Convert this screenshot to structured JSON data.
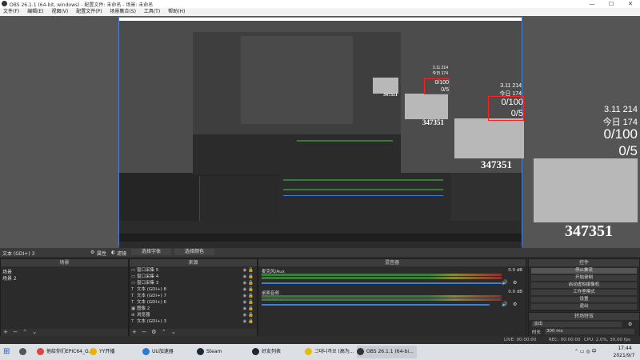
{
  "window": {
    "title": "OBS 26.1.1 (64-bit, windows) - 配置文件: 未命名 - 场景: 未命名",
    "minimize": "—",
    "maximize": "☐",
    "close": "✕"
  },
  "menu": [
    "文件(F)",
    "编辑(E)",
    "视图(V)",
    "配置文件(P)",
    "场景集合(S)",
    "工具(T)",
    "帮助(H)"
  ],
  "overlay": {
    "date": "3.11 214",
    "today": "今日 174",
    "ratio": "0/100",
    "count": "0/5",
    "number": "347351"
  },
  "source_label": "文本 (GDI+) 3",
  "properties_label": "属性",
  "filters_label": "滤镜",
  "select_font": "选择字体",
  "select_color": "选择颜色",
  "scenes_panel": {
    "header": "场景",
    "items": [
      "场景",
      "场景 2"
    ]
  },
  "sources_panel": {
    "header": "来源",
    "items": [
      "窗口采集 5",
      "窗口采集 4",
      "窗口采集 3",
      "文本 (GDI+) 8",
      "文本 (GDI+) 7",
      "文本 (GDI+) 6",
      "图像 2",
      "浏览器",
      "文本 (GDI+) 3"
    ]
  },
  "mixer_panel": {
    "header": "混音器",
    "channels": [
      {
        "name": "麦克风/Aux",
        "db": "0.0 dB"
      },
      {
        "name": "桌面音频",
        "db": "0.0 dB"
      }
    ]
  },
  "controls_panel": {
    "header": "控件",
    "buttons": [
      "停止推流",
      "开始录制",
      "启动虚拟摄像机",
      "工作室模式",
      "设置",
      "退出"
    ]
  },
  "transitions_panel": {
    "header": "转场特效",
    "selected": "淡出",
    "duration_label": "时长",
    "duration_value": "300 ms"
  },
  "status": {
    "live": "LIVE: 00:00:00",
    "rec": "REC: 00:00:00",
    "cpu": "CPU: 2.0%, 30.00 fps"
  },
  "taskbar": {
    "items": [
      "他给你们EPIC64_G...",
      "YY开播",
      "UU加速器",
      "Steam",
      "好友列表",
      "그대니까요 (高为...",
      "OBS 26.1.1 (64-bi..."
    ],
    "time": "17:44",
    "date": "2021/9/7"
  }
}
